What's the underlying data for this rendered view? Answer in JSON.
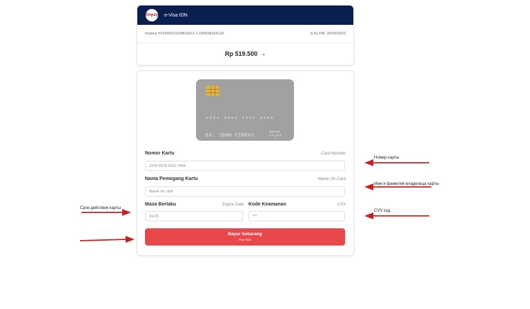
{
  "header": {
    "logo_text": "finpay",
    "title": "e-Visa IDN"
  },
  "invoice": {
    "number": "Invoice #V260923193801813 2-230928164126",
    "datetime": "6:41 PM, 26/09/2023"
  },
  "amount": {
    "value": "Rp 519.500",
    "toggle_icon": "chevron-down-icon"
  },
  "card_preview": {
    "number": "**** **** **** ****",
    "name": "EX. JOHN FINPAY",
    "valid_label": "valid thru",
    "valid": "**/**"
  },
  "form": {
    "card_number": {
      "label": "Nomor Kartu",
      "hint": "Card Number",
      "placeholder": "1234 5678 9012 3456"
    },
    "card_holder": {
      "label": "Nama Pemegang Kartu",
      "hint": "Name On Card",
      "placeholder": "Name on card"
    },
    "expiry": {
      "label": "Masa Berlaku",
      "hint": "Expiry Date",
      "placeholder": "01/25"
    },
    "cvv": {
      "label": "Kode Keamanan",
      "hint": "CVV",
      "placeholder": "***"
    },
    "submit": {
      "label": "Bayar Sekarang",
      "sublabel": "Pay Now"
    }
  },
  "annotations": {
    "card_number": "Номер карты",
    "card_holder": "Имя и фамилия владельца карты",
    "cvv": "CVV код",
    "expiry": "Срок действия карты"
  },
  "colors": {
    "navbar": "#0b1f4f",
    "button": "#e8484a",
    "arrow": "#cc1f1f",
    "card": "#a1a1a1"
  }
}
